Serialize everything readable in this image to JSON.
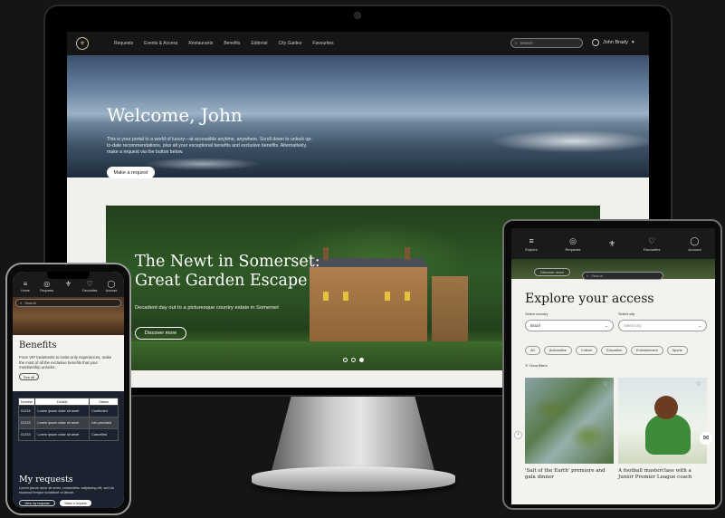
{
  "desktop": {
    "nav_logo": "⚜",
    "nav_links": [
      "Requests",
      "Events & Access",
      "Restaurants",
      "Benefits",
      "Editorial",
      "City Guides",
      "Favourites"
    ],
    "search_placeholder": "Search",
    "user_name": "John Brady",
    "hero_title": "Welcome, John",
    "hero_text": "This is your portal to a world of luxury—at accessible anytime, anywhere. Scroll down to unlock up-to-date recommendations, plus all your exceptional benefits and exclusive benefits. Alternatively, make a request via the button below.",
    "hero_button": "Make a request",
    "feature_title_1": "The Newt in Somerset:",
    "feature_title_2": "Great Garden Escape",
    "feature_subtitle": "Decadent day out to a picturesque country estate in Somerset",
    "feature_button": "Discover more",
    "carousel_active": 3
  },
  "phone": {
    "nav": [
      "Home",
      "Requests",
      "",
      "Favourites",
      "Account"
    ],
    "search_placeholder": "Search",
    "benefits_title": "Benefits",
    "benefits_text": "From VIP treatments to invite-only experiences, make the most of all the exclusive benefits that your membership unlocks.",
    "benefits_button": "See all",
    "table_headers": [
      "Number",
      "Details",
      "Status"
    ],
    "table_rows": [
      {
        "number": "01234",
        "details": "Lorem ipsum dolor sit amet",
        "status": "Confirmed"
      },
      {
        "number": "01233",
        "details": "Lorem ipsum dolor sit amet",
        "status": "Info provided"
      },
      {
        "number": "01233",
        "details": "Lorem ipsum dolor sit amet",
        "status": "Cancelled"
      }
    ],
    "requests_title": "My requests",
    "requests_text": "Lorem ipsum dolor sit amet, consectetur adipiscing elit, sed do eiusmod tempor incididunt ut labore.",
    "button_view": "View my requests",
    "button_make": "Make a request"
  },
  "tablet": {
    "nav": [
      "Explore",
      "Requests",
      "",
      "Favourites",
      "Account"
    ],
    "discover_label": "Discover more",
    "search_placeholder": "Search",
    "title": "Explore your access",
    "country_label": "Select country",
    "country_value": "Brazil",
    "city_label": "Select city",
    "city_value": "Select city",
    "chips": [
      "Art",
      "Automotive",
      "Culture",
      "Education",
      "Entertainment",
      "Sports"
    ],
    "clear_filters": "Clear filters",
    "card1_caption": "'Salt of the Earth' premiere and gala dinner",
    "card2_caption": "A football masterclass with a Junior Premier League coach"
  }
}
